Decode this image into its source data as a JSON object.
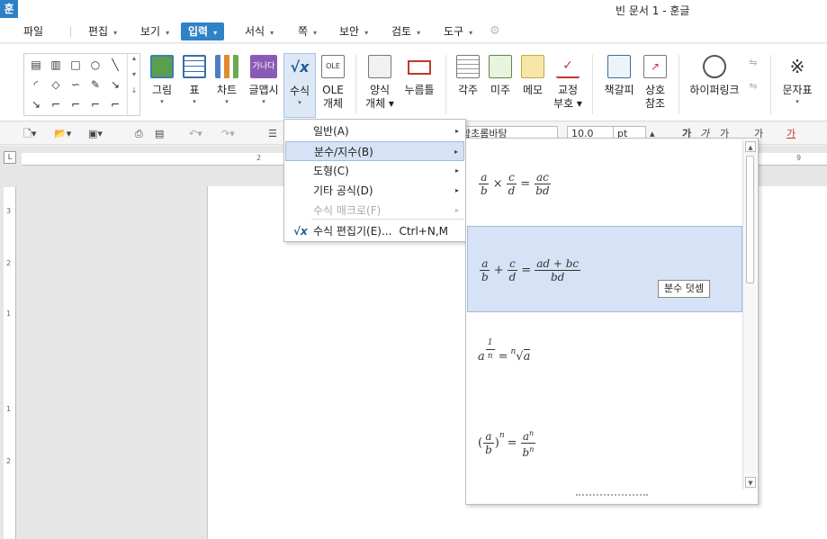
{
  "window": {
    "app_icon": "훈",
    "title": "빈 문서 1 - 훈글"
  },
  "menubar": {
    "items": [
      {
        "label": "파일",
        "arrow": ""
      },
      {
        "label": "편집",
        "arrow": "▾"
      },
      {
        "label": "보기",
        "arrow": "▾"
      },
      {
        "label": "입력",
        "arrow": "▾"
      },
      {
        "label": "서식",
        "arrow": "▾"
      },
      {
        "label": "쪽",
        "arrow": "▾"
      },
      {
        "label": "보안",
        "arrow": "▾"
      },
      {
        "label": "검토",
        "arrow": "▾"
      },
      {
        "label": "도구",
        "arrow": "▾"
      }
    ]
  },
  "ribbon": {
    "buttons": [
      {
        "label": "그림",
        "label2": "",
        "arrow": "▾"
      },
      {
        "label": "표",
        "label2": "",
        "arrow": "▾"
      },
      {
        "label": "차트",
        "label2": "",
        "arrow": "▾"
      },
      {
        "label": "글맵시",
        "label2": "",
        "arrow": "▾"
      },
      {
        "label": "수식",
        "label2": "",
        "arrow": "▾"
      },
      {
        "label": "OLE",
        "label2": "개체",
        "arrow": ""
      },
      {
        "label": "양식",
        "label2": "개체 ▾",
        "arrow": ""
      },
      {
        "label": "누름틀",
        "label2": "",
        "arrow": ""
      },
      {
        "label": "각주",
        "label2": "",
        "arrow": ""
      },
      {
        "label": "미주",
        "label2": "",
        "arrow": ""
      },
      {
        "label": "메모",
        "label2": "",
        "arrow": ""
      },
      {
        "label": "교정",
        "label2": "부호 ▾",
        "arrow": ""
      },
      {
        "label": "책갈피",
        "label2": "",
        "arrow": ""
      },
      {
        "label": "상호",
        "label2": "참조",
        "arrow": ""
      },
      {
        "label": "하이퍼링크",
        "label2": "",
        "arrow": ""
      },
      {
        "label": "문자표",
        "label2": "",
        "arrow": "▾"
      }
    ]
  },
  "toolbar2": {
    "font_name": "함초롬바탕",
    "font_size": "10.0",
    "size_unit": "pt",
    "char_buttons": [
      "가",
      "가",
      "가",
      "가"
    ],
    "color_button": "가"
  },
  "ruler": {
    "h_nums": [
      "2",
      "9"
    ],
    "v_nums": [
      "3",
      "2",
      "1",
      "1",
      "2"
    ]
  },
  "dropdown": {
    "items": [
      {
        "label": "일반(A)",
        "shortcut": "",
        "submenu": "▸",
        "state": "normal"
      },
      {
        "label": "분수/지수(B)",
        "shortcut": "",
        "submenu": "▸",
        "state": "highlighted"
      },
      {
        "label": "도형(C)",
        "shortcut": "",
        "submenu": "▸",
        "state": "normal"
      },
      {
        "label": "기타 공식(D)",
        "shortcut": "",
        "submenu": "▸",
        "state": "normal"
      },
      {
        "label": "수식 매크로(F)",
        "shortcut": "",
        "submenu": "▸",
        "state": "disabled"
      },
      {
        "label": "수식 편집기(E)...",
        "shortcut": "Ctrl+N,M",
        "submenu": "",
        "state": "normal"
      }
    ],
    "editor_icon": "√x"
  },
  "gallery": {
    "tooltip": "분수 덧셈",
    "formulas": [
      {
        "name": "fraction-multiply"
      },
      {
        "name": "fraction-add"
      },
      {
        "name": "fractional-exponent"
      },
      {
        "name": "fraction-power"
      }
    ]
  }
}
